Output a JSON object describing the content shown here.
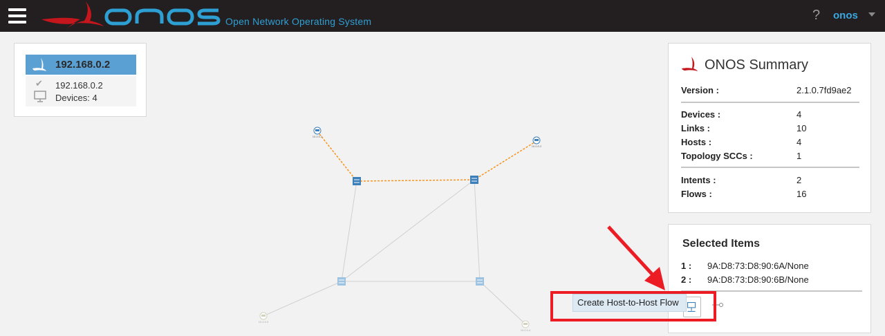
{
  "app": {
    "logo_text": "ONOS",
    "subtitle": "Open Network Operating System",
    "help_label": "?",
    "user": "onos"
  },
  "cluster": {
    "title": "192.168.0.2",
    "node_ip": "192.168.0.2",
    "devices_text": "Devices: 4"
  },
  "summary": {
    "title": "ONOS Summary",
    "rows": [
      {
        "key": "Version :",
        "value": "2.1.0.7fd9ae2"
      },
      {
        "key": "Devices :",
        "value": "4"
      },
      {
        "key": "Links :",
        "value": "10"
      },
      {
        "key": "Hosts :",
        "value": "4"
      },
      {
        "key": "Topology SCCs :",
        "value": "1"
      },
      {
        "key": "Intents :",
        "value": "2"
      },
      {
        "key": "Flows :",
        "value": "16"
      }
    ]
  },
  "selected": {
    "title": "Selected Items",
    "items": [
      {
        "index": "1 :",
        "value": "9A:D8:73:D8:90:6A/None"
      },
      {
        "index": "2 :",
        "value": "9A:D8:73:D8:90:6B/None"
      }
    ]
  },
  "action": {
    "tooltip": "Create Host-to-Host Flow"
  },
  "topology": {
    "host_labels": [
      "10.0.0.1",
      "10.0.0.2",
      "10.0.0.3",
      "10.0.0.4"
    ]
  },
  "colors": {
    "topbar": "#231f20",
    "brand_blue": "#2e9fd3",
    "brand_red": "#c4161c",
    "selected_link": "#f7941d",
    "switch": "#5ba0d3",
    "annotation_red": "#ec1c24"
  }
}
